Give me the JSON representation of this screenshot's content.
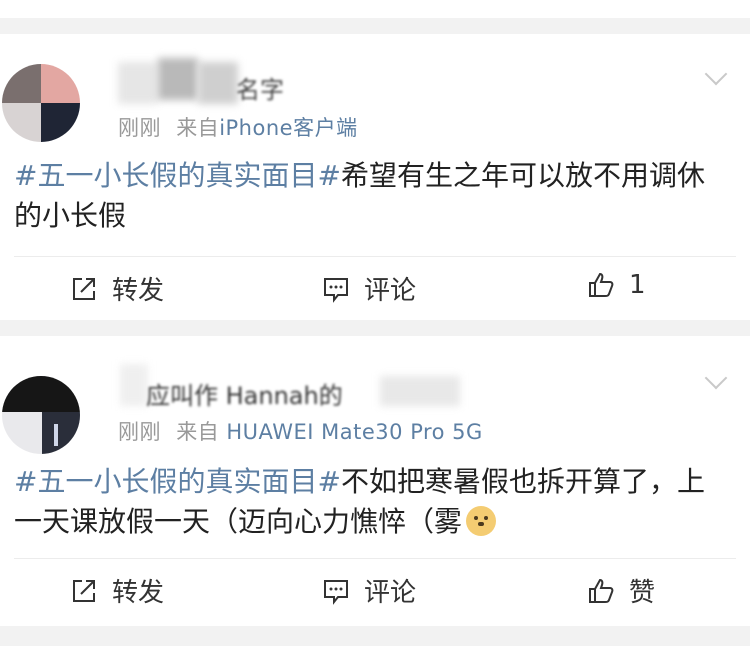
{
  "posts": [
    {
      "username_visible": "名字",
      "time": "刚刚",
      "source_prefix": "来自",
      "device": "iPhone客户端",
      "hashtag": "#五一小长假的真实面目#",
      "text": "希望有生之年可以放不用调休的小长假",
      "actions": {
        "repost": "转发",
        "comment": "评论",
        "like": "1"
      }
    },
    {
      "username_visible": "应叫作 Hannah的",
      "time": "刚刚",
      "source_prefix": "来自",
      "device": "HUAWEI Mate30 Pro 5G",
      "hashtag": "#五一小长假的真实面目#",
      "text": "不如把寒暑假也拆开算了，上一天课放假一天（迈向心力憔悴（雾",
      "actions": {
        "repost": "转发",
        "comment": "评论",
        "like": "赞"
      }
    }
  ],
  "colors": {
    "link": "#5d7fa3",
    "meta": "#999999",
    "text": "#222222",
    "background": "#f2f2f2"
  },
  "icons": {
    "repost": "repost-icon",
    "comment": "comment-icon",
    "like": "thumbs-up-icon",
    "more": "chevron-down-icon",
    "emoji": "doge-emoji"
  }
}
